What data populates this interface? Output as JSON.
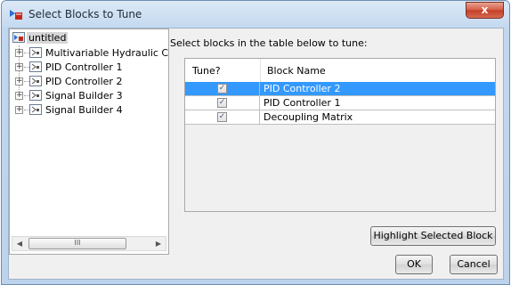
{
  "window": {
    "title": "Select Blocks to Tune",
    "close_glyph": "x"
  },
  "tree": {
    "root_label": "untitled",
    "items": [
      {
        "label": "Multivariable Hydraulic Cy"
      },
      {
        "label": "PID Controller 1"
      },
      {
        "label": "PID Controller 2"
      },
      {
        "label": "Signal Builder 3"
      },
      {
        "label": "Signal Builder 4"
      }
    ],
    "expander_glyph": "+",
    "scroll_left": "◀",
    "scroll_right": "▶",
    "scroll_grip": "III"
  },
  "instructions": "Select blocks in the table below to tune:",
  "table": {
    "headers": [
      "Tune?",
      "Block Name"
    ],
    "rows": [
      {
        "tune": "✓",
        "name": "PID Controller 2",
        "selected": true
      },
      {
        "tune": "✓",
        "name": "PID Controller 1",
        "selected": false
      },
      {
        "tune": "✓",
        "name": "Decoupling Matrix",
        "selected": false
      }
    ]
  },
  "buttons": {
    "highlight": "Highlight Selected Block",
    "ok": "OK",
    "cancel": "Cancel"
  },
  "icons": [
    "app-icon",
    "close-icon",
    "block-icon",
    "expander-icon",
    "checkbox-icon"
  ]
}
